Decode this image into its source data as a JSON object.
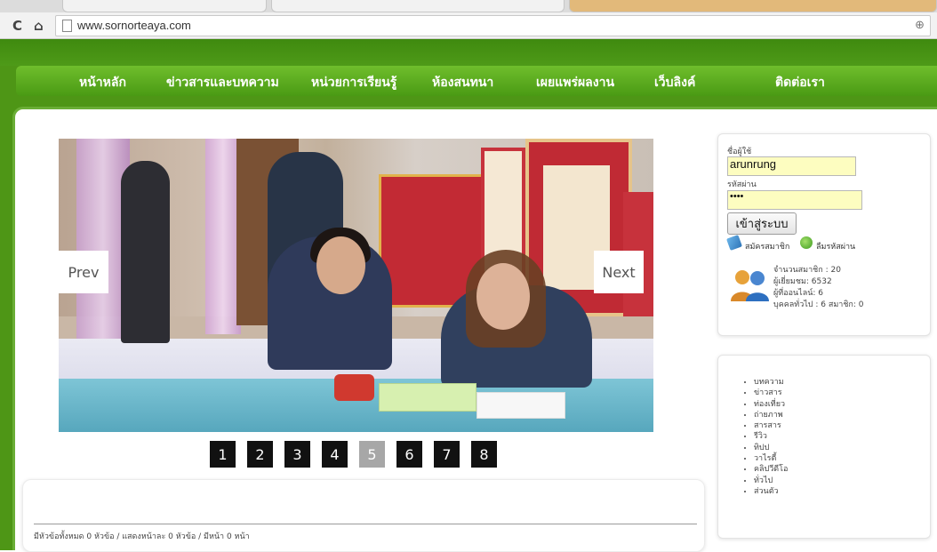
{
  "browser": {
    "url": "www.sornorteaya.com"
  },
  "menu": {
    "items": [
      {
        "label": "หน้าหลัก"
      },
      {
        "label": "ข่าวสารและบทความ"
      },
      {
        "label": "หน่วยการเรียนรู้"
      },
      {
        "label": "ห้องสนทนา"
      },
      {
        "label": "เผยแพร่ผลงาน"
      },
      {
        "label": "เว็บลิงค์"
      },
      {
        "label": "ติดต่อเรา"
      }
    ]
  },
  "slider": {
    "prev_label": "Prev",
    "next_label": "Next",
    "pages": [
      "1",
      "2",
      "3",
      "4",
      "5",
      "6",
      "7",
      "8"
    ],
    "active_page": "5"
  },
  "news": {
    "count_text": "มีหัวข้อทั้งหมด 0 หัวข้อ / แสดงหน้าละ 0 หัวข้อ / มีหน้า 0 หน้า"
  },
  "login": {
    "username_label": "ชื่อผู้ใช้",
    "username_value": "arunrung",
    "password_label": "รหัสผ่าน",
    "password_value": "••••",
    "login_button": "เข้าสู่ระบบ",
    "register_link": "สมัครสมาชิก",
    "forgot_link": "ลืมรหัสผ่าน",
    "stats": {
      "members": "จำนวนสมาชิก : 20",
      "visitors": "ผู้เยี่ยมชม: 6532",
      "online": "ผู้ที่ออนไลน์: 6",
      "breakdown": "บุคคลทั่วไป : 6 สมาชิก: 0"
    }
  },
  "categories": [
    "บทความ",
    "ข่าวสาร",
    "ท่องเที่ยว",
    "ถ่ายภาพ",
    "สารสาร",
    "รีวิว",
    "ทิปป",
    "วาไรตี้",
    "คลิปวีดีโอ",
    "ทั่วไป",
    "ส่วนตัว"
  ],
  "colors": {
    "brand_green": "#4e9616",
    "menu_green": "#6fbe2c",
    "active_pager": "#a7a7a7",
    "input_highlight": "#fdfdc0"
  }
}
